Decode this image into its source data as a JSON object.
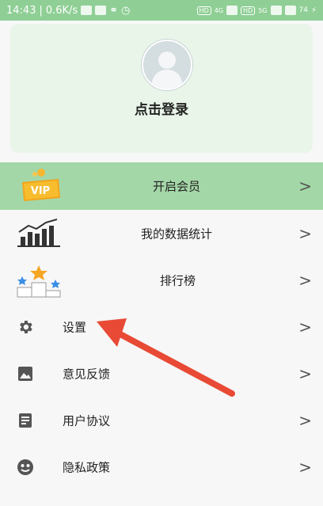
{
  "status_bar": {
    "time": "14:43",
    "speed": "0.6K/s",
    "badge_hd": "HD",
    "signal_4g": "4G",
    "signal_5g": "5G",
    "battery": "74"
  },
  "header": {
    "login_label": "点击登录"
  },
  "menu": {
    "vip_label": "开启会员",
    "vip_badge_text": "VIP",
    "stats_label": "我的数据统计",
    "ranking_label": "排行榜",
    "settings_label": "设置",
    "feedback_label": "意见反馈",
    "agreement_label": "用户协议",
    "privacy_label": "隐私政策",
    "chevron": ">"
  },
  "colors": {
    "status_bar": "#8fcf95",
    "header_card": "#e9f5e9",
    "vip_row": "#a4d7a7",
    "annotation_arrow": "#e84a35"
  }
}
